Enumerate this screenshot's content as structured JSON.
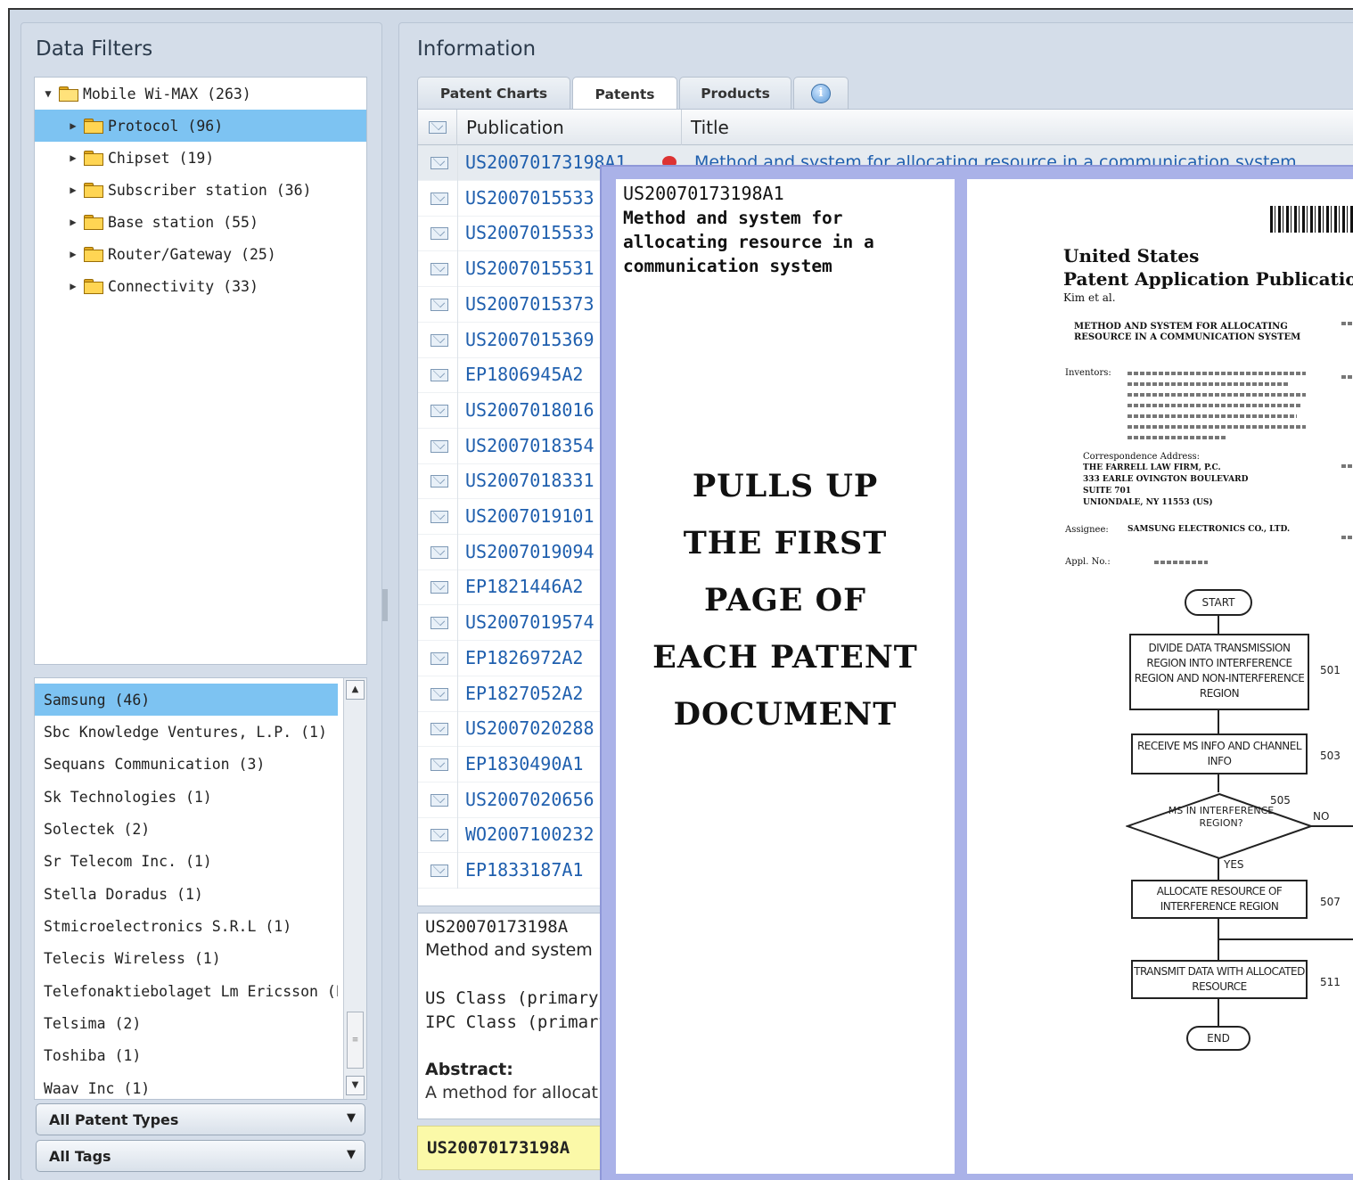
{
  "left_panel": {
    "title": "Data Filters",
    "tree": {
      "root": "Mobile Wi-MAX (263)",
      "children": [
        "Protocol (96)",
        "Chipset (19)",
        "Subscriber station (36)",
        "Base station (55)",
        "Router/Gateway (25)",
        "Connectivity (33)"
      ],
      "selected_index": 0
    },
    "companies": [
      "Samsung (46)",
      "Sbc Knowledge Ventures, L.P. (1)",
      "Sequans Communication (3)",
      "Sk Technologies (1)",
      "Solectek (2)",
      "Sr Telecom Inc. (1)",
      "Stella Doradus (1)",
      "Stmicroelectronics S.R.L (1)",
      "Telecis Wireless (1)",
      "Telefonaktiebolaget Lm Ericsson (P",
      "Telsima (2)",
      "Toshiba (1)",
      "Waav Inc (1)"
    ],
    "dropdowns": {
      "patent_types": "All Patent Types",
      "tags": "All Tags"
    }
  },
  "right_panel": {
    "title": "Information",
    "tabs": [
      "Patent Charts",
      "Patents",
      "Products"
    ],
    "active_tab": "Patents",
    "table": {
      "headers": [
        "Publication",
        "Title"
      ],
      "first_row_title": "Method and system for allocating resource in a communication system",
      "rows": [
        "US20070173198A1",
        "US2007015533",
        "US2007015533",
        "US2007015531",
        "US2007015373",
        "US2007015369",
        "EP1806945A2",
        "US2007018016",
        "US2007018354",
        "US2007018331",
        "US2007019101",
        "US2007019094",
        "EP1821446A2",
        "US2007019574",
        "EP1826972A2",
        "EP1827052A2",
        "US2007020288",
        "EP1830490A1",
        "US2007020656",
        "WO2007100232",
        "EP1833187A1"
      ]
    },
    "detail": {
      "id": "US20070173198A",
      "title": "Method and system",
      "us_class": "US Class (primary",
      "ipc_class": "IPC Class (primary",
      "abstract_label": "Abstract:",
      "abstract_text": "A method for allocat"
    },
    "footer_id": "US20070173198A"
  },
  "popup": {
    "id": "US20070173198A1",
    "description": "Method and system for allocating resource in a communication system",
    "callout_lines": [
      "PULLS UP",
      "THE FIRST",
      "PAGE OF",
      "EACH PATENT",
      "DOCUMENT"
    ],
    "document": {
      "country": "United States",
      "pub_type": "Patent Application Publication",
      "authors": "Kim et al.",
      "doc_title": "METHOD AND SYSTEM FOR ALLOCATING RESOURCE IN A COMMUNICATION SYSTEM",
      "inventors_label": "Inventors:",
      "correspondence_label": "Correspondence Address:",
      "correspondence_firm": "THE FARRELL LAW FIRM, P.C.",
      "correspondence_street": "333 EARLE OVINGTON BOULEVARD",
      "correspondence_suite": "SUITE 701",
      "correspondence_city": "UNIONDALE, NY 11553 (US)",
      "assignee_label": "Assignee:",
      "assignee": "SAMSUNG ELECTRONICS CO., LTD.",
      "appl_label": "Appl. No.:",
      "flow": {
        "start": "START",
        "step_501": "DIVIDE DATA TRANSMISSION REGION INTO INTERFERENCE REGION AND NON-INTERFERENCE REGION",
        "step_503": "RECEIVE MS INFO AND CHANNEL INFO",
        "step_505": "MS IN INTERFERENCE REGION?",
        "yes": "YES",
        "no": "NO",
        "step_507": "ALLOCATE RESOURCE OF INTERFERENCE REGION",
        "step_511": "TRANSMIT DATA WITH ALLOCATED RESOURCE",
        "end": "END",
        "refs": [
          "501",
          "503",
          "505",
          "507",
          "511"
        ]
      }
    }
  }
}
